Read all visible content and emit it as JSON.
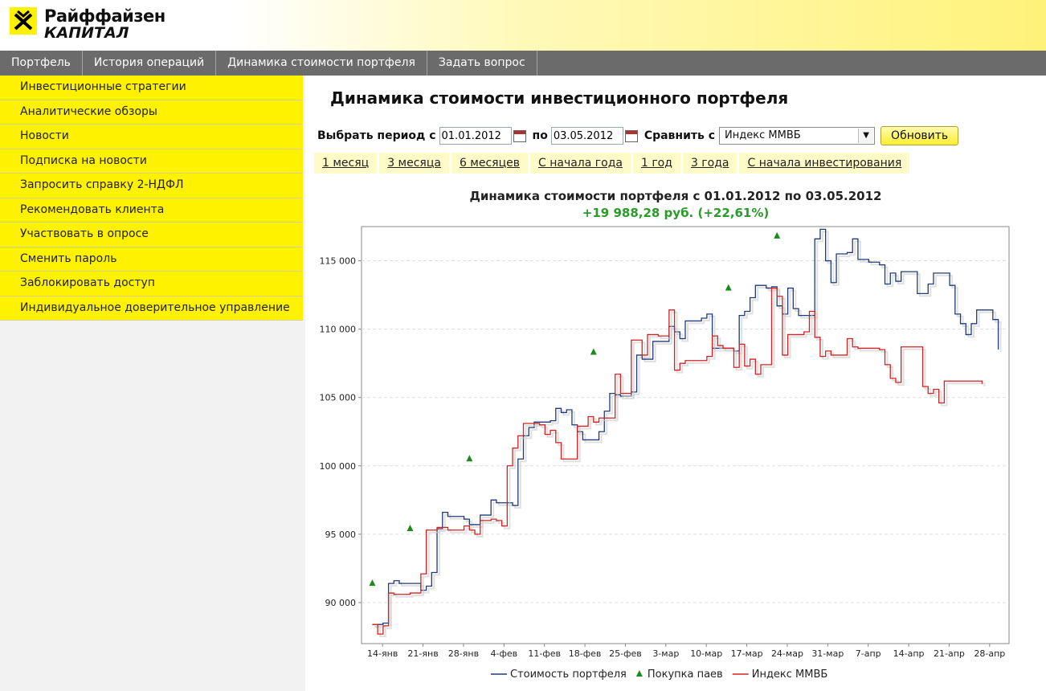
{
  "brand": {
    "line1": "Райффайзен",
    "line2": "КАПИТАЛ"
  },
  "topnav": [
    "Портфель",
    "История операций",
    "Динамика стоимости портфеля",
    "Задать вопрос"
  ],
  "sidebar": [
    "Инвестиционные стратегии",
    "Аналитические обзоры",
    "Новости",
    "Подписка на новости",
    "Запросить справку 2-НДФЛ",
    "Рекомендовать клиента",
    "Участвовать в опросе",
    "Сменить пароль",
    "Заблокировать доступ",
    "Индивидуальное доверительное управление"
  ],
  "page_title": "Динамика стоимости инвестиционного портфеля",
  "filter": {
    "period_label": "Выбрать период с",
    "from_value": "01.01.2012",
    "to_label": "по",
    "to_value": "03.05.2012",
    "compare_label": "Сравнить с",
    "compare_value": "Индекс ММВБ",
    "refresh_label": "Обновить"
  },
  "period_tabs": [
    "1 месяц",
    "3 месяца",
    "6 месяцев",
    "С начала года",
    "1 год",
    "3 года",
    "С начала инвестирования"
  ],
  "colors": {
    "portfolio": "#1f3a7a",
    "index": "#d42020",
    "purchase": "#1a8a1a",
    "gain": "#2a9a2a"
  },
  "chart_data": {
    "type": "line",
    "title": "Динамика стоимости портфеля с 01.01.2012 по 03.05.2012",
    "subtitle": "+19 988,28 руб. (+22,61%)",
    "categories": [
      "14-янв",
      "21-янв",
      "28-янв",
      "4-фев",
      "11-фев",
      "18-фев",
      "25-фев",
      "3-мар",
      "10-мар",
      "17-мар",
      "24-мар",
      "31-мар",
      "7-апр",
      "14-апр",
      "21-апр",
      "28-апр"
    ],
    "xlim": [
      0,
      120
    ],
    "ylim": [
      87000,
      117500
    ],
    "yticks": [
      90000,
      95000,
      100000,
      105000,
      110000,
      115000
    ],
    "ytick_labels": [
      "90 000",
      "95 000",
      "100 000",
      "105 000",
      "110 000",
      "115 000"
    ],
    "grid": true,
    "legend_position": "bottom",
    "series": [
      {
        "name": "Стоимость портфеля",
        "step": true,
        "points": [
          [
            2,
            88400
          ],
          [
            4,
            88500
          ],
          [
            5,
            91400
          ],
          [
            6,
            91600
          ],
          [
            7,
            91400
          ],
          [
            10,
            91400
          ],
          [
            11,
            90900
          ],
          [
            12,
            91200
          ],
          [
            13,
            92200
          ],
          [
            14,
            95400
          ],
          [
            15,
            96600
          ],
          [
            16,
            96300
          ],
          [
            19,
            96100
          ],
          [
            20,
            95700
          ],
          [
            21,
            95700
          ],
          [
            22,
            96400
          ],
          [
            24,
            97500
          ],
          [
            25,
            97300
          ],
          [
            26,
            97300
          ],
          [
            28,
            97100
          ],
          [
            29,
            100500
          ],
          [
            30,
            102200
          ],
          [
            31,
            102800
          ],
          [
            32,
            103200
          ],
          [
            35,
            103300
          ],
          [
            36,
            104200
          ],
          [
            37,
            103900
          ],
          [
            38,
            104100
          ],
          [
            39,
            103000
          ],
          [
            40,
            102500
          ],
          [
            41,
            101900
          ],
          [
            44,
            102500
          ],
          [
            45,
            104000
          ],
          [
            46,
            105300
          ],
          [
            47,
            105200
          ],
          [
            48,
            105100
          ],
          [
            50,
            105400
          ],
          [
            51,
            108100
          ],
          [
            52,
            107800
          ],
          [
            54,
            109100
          ],
          [
            55,
            109100
          ],
          [
            57,
            110200
          ],
          [
            58,
            109800
          ],
          [
            59,
            109300
          ],
          [
            60,
            110600
          ],
          [
            63,
            110800
          ],
          [
            64,
            111100
          ],
          [
            65,
            108600
          ],
          [
            69,
            108400
          ],
          [
            70,
            111000
          ],
          [
            71,
            111300
          ],
          [
            72,
            112300
          ],
          [
            73,
            113200
          ],
          [
            75,
            113000
          ],
          [
            76,
            113100
          ],
          [
            77,
            111700
          ],
          [
            78,
            111100
          ],
          [
            79,
            113000
          ],
          [
            80,
            111500
          ],
          [
            81,
            111000
          ],
          [
            84,
            116600
          ],
          [
            85,
            117300
          ],
          [
            86,
            115000
          ],
          [
            87,
            113400
          ],
          [
            88,
            115500
          ],
          [
            90,
            115600
          ],
          [
            91,
            116600
          ],
          [
            92,
            115100
          ],
          [
            94,
            114900
          ],
          [
            96,
            114700
          ],
          [
            97,
            113300
          ],
          [
            98,
            114100
          ],
          [
            99,
            113500
          ],
          [
            100,
            114200
          ],
          [
            102,
            114200
          ],
          [
            103,
            112600
          ],
          [
            105,
            113300
          ],
          [
            106,
            114100
          ],
          [
            109,
            113200
          ],
          [
            110,
            111100
          ],
          [
            111,
            110400
          ],
          [
            112,
            109600
          ],
          [
            113,
            110400
          ],
          [
            114,
            111400
          ],
          [
            117,
            110700
          ],
          [
            118,
            108500
          ]
        ]
      },
      {
        "name": "Индекс ММВБ",
        "step": true,
        "points": [
          [
            2,
            88400
          ],
          [
            3,
            87700
          ],
          [
            4,
            88300
          ],
          [
            5,
            90700
          ],
          [
            6,
            90600
          ],
          [
            9,
            90700
          ],
          [
            10,
            90700
          ],
          [
            11,
            92100
          ],
          [
            12,
            95300
          ],
          [
            14,
            95500
          ],
          [
            16,
            95300
          ],
          [
            19,
            95600
          ],
          [
            20,
            95300
          ],
          [
            21,
            95000
          ],
          [
            22,
            96000
          ],
          [
            24,
            96100
          ],
          [
            25,
            96000
          ],
          [
            26,
            95600
          ],
          [
            27,
            100000
          ],
          [
            28,
            101300
          ],
          [
            29,
            102200
          ],
          [
            30,
            103100
          ],
          [
            33,
            103000
          ],
          [
            34,
            102300
          ],
          [
            35,
            102600
          ],
          [
            36,
            101700
          ],
          [
            37,
            100500
          ],
          [
            40,
            102900
          ],
          [
            42,
            103600
          ],
          [
            43,
            103200
          ],
          [
            44,
            103500
          ],
          [
            47,
            106700
          ],
          [
            48,
            105300
          ],
          [
            50,
            109200
          ],
          [
            51,
            109200
          ],
          [
            52,
            108100
          ],
          [
            53,
            109600
          ],
          [
            55,
            109500
          ],
          [
            57,
            111400
          ],
          [
            58,
            107000
          ],
          [
            59,
            107500
          ],
          [
            60,
            107700
          ],
          [
            64,
            108000
          ],
          [
            65,
            109500
          ],
          [
            66,
            108800
          ],
          [
            67,
            108600
          ],
          [
            69,
            107200
          ],
          [
            70,
            108900
          ],
          [
            71,
            107300
          ],
          [
            72,
            107800
          ],
          [
            73,
            106700
          ],
          [
            74,
            107400
          ],
          [
            76,
            113000
          ],
          [
            77,
            112400
          ],
          [
            78,
            108100
          ],
          [
            79,
            109600
          ],
          [
            82,
            109800
          ],
          [
            83,
            111300
          ],
          [
            84,
            109400
          ],
          [
            85,
            108000
          ],
          [
            86,
            108400
          ],
          [
            87,
            108100
          ],
          [
            90,
            109300
          ],
          [
            91,
            108700
          ],
          [
            92,
            108600
          ],
          [
            96,
            108500
          ],
          [
            97,
            107400
          ],
          [
            98,
            106400
          ],
          [
            99,
            106100
          ],
          [
            100,
            108700
          ],
          [
            103,
            108700
          ],
          [
            104,
            105800
          ],
          [
            105,
            105300
          ],
          [
            106,
            105600
          ],
          [
            107,
            104600
          ],
          [
            108,
            106200
          ],
          [
            114,
            106200
          ],
          [
            115,
            106000
          ]
        ]
      }
    ],
    "purchases": {
      "name": "Покупка паев",
      "points": [
        [
          2,
          91400
        ],
        [
          9,
          95400
        ],
        [
          20,
          100500
        ],
        [
          43,
          108300
        ],
        [
          77,
          116800
        ],
        [
          68,
          113000
        ]
      ]
    }
  }
}
